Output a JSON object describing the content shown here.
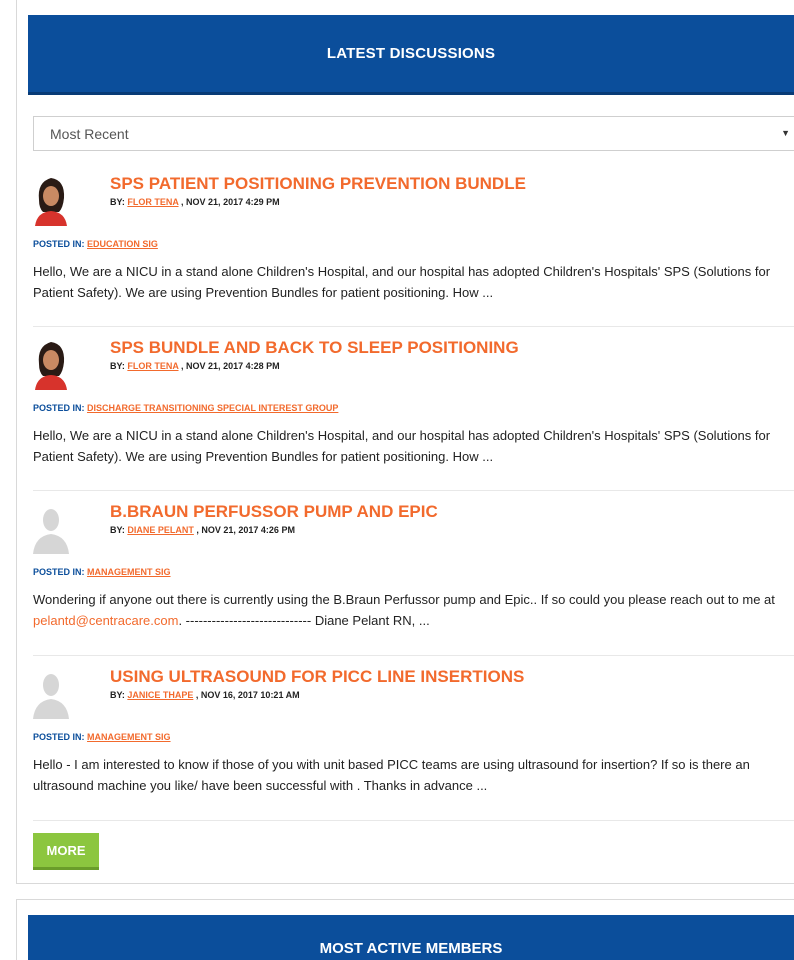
{
  "discussions": {
    "header": "LATEST DISCUSSIONS",
    "sort": {
      "selected": "Most Recent"
    },
    "posts": [
      {
        "title": "SPS PATIENT POSITIONING PREVENTION BUNDLE",
        "by_label": "BY:",
        "author": "FLOR TENA",
        "date": ", NOV 21, 2017 4:29 PM",
        "posted_label": "POSTED IN:",
        "group": "EDUCATION SIG",
        "excerpt": "Hello, We are a NICU in a stand alone Children's Hospital, and our hospital has adopted Children's Hospitals' SPS (Solutions for Patient Safety). We are using Prevention Bundles for patient positioning. How ...",
        "avatar": "user-photo"
      },
      {
        "title": "SPS BUNDLE AND BACK TO SLEEP POSITIONING",
        "by_label": "BY:",
        "author": "FLOR TENA",
        "date": ", NOV 21, 2017 4:28 PM",
        "posted_label": "POSTED IN:",
        "group": "DISCHARGE TRANSITIONING SPECIAL INTEREST GROUP",
        "excerpt": "Hello, We are a NICU in a stand alone Children's Hospital, and our hospital has adopted Children's Hospitals' SPS (Solutions for Patient Safety). We are using Prevention Bundles for patient positioning. How ...",
        "avatar": "user-photo"
      },
      {
        "title": "B.BRAUN PERFUSSOR PUMP AND EPIC",
        "by_label": "BY:",
        "author": "DIANE PELANT",
        "date": ", NOV 21, 2017 4:26 PM",
        "posted_label": "POSTED IN:",
        "group": "MANAGEMENT SIG",
        "excerpt_before": "Wondering if anyone out there is currently using the B.Braun Perfussor pump and Epic.. If so could you please reach out to me at ",
        "excerpt_link": "pelantd@centracare.com",
        "excerpt_after": ". ----------------------------- Diane Pelant RN, ...",
        "avatar": "default-avatar"
      },
      {
        "title": "USING ULTRASOUND FOR PICC LINE INSERTIONS",
        "by_label": "BY:",
        "author": "JANICE THAPE",
        "date": ", NOV 16, 2017 10:21 AM",
        "posted_label": "POSTED IN:",
        "group": "MANAGEMENT SIG",
        "excerpt": "Hello - I am interested to know if those of you with unit based PICC teams are using ultrasound for insertion? If so is there an ultrasound machine you like/ have been successful with . Thanks in advance ...",
        "avatar": "default-avatar"
      }
    ],
    "more_label": "MORE"
  },
  "members": {
    "header": "MOST ACTIVE MEMBERS"
  },
  "colors": {
    "header_blue": "#0b4e9b",
    "title_orange": "#f26a2d",
    "more_green": "#8cc63f"
  }
}
